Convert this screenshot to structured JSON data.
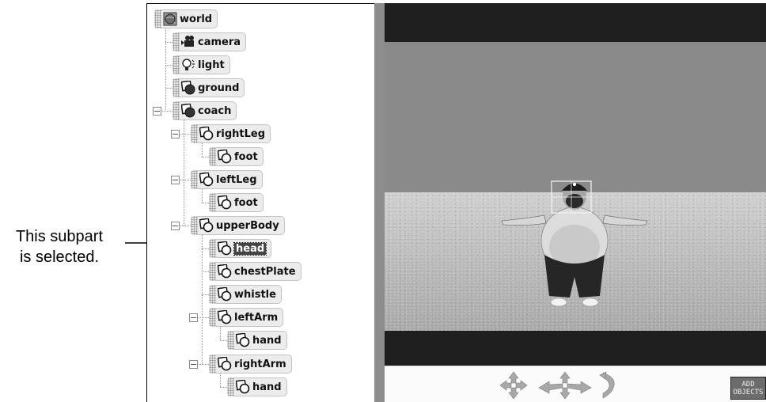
{
  "annotation": {
    "line1": "This subpart",
    "line2": "is selected."
  },
  "tree": {
    "nodes": [
      {
        "label": "world",
        "icon": "world-globe-icon",
        "selected": false
      },
      {
        "label": "camera",
        "icon": "camera-icon",
        "selected": false
      },
      {
        "label": "light",
        "icon": "light-bulb-icon",
        "selected": false
      },
      {
        "label": "ground",
        "icon": "object-icon",
        "selected": false
      },
      {
        "label": "coach",
        "icon": "object-icon",
        "selected": false
      },
      {
        "label": "rightLeg",
        "icon": "object-icon",
        "selected": false
      },
      {
        "label": "foot",
        "icon": "object-icon",
        "selected": false
      },
      {
        "label": "leftLeg",
        "icon": "object-icon",
        "selected": false
      },
      {
        "label": "foot",
        "icon": "object-icon",
        "selected": false
      },
      {
        "label": "upperBody",
        "icon": "object-icon",
        "selected": false
      },
      {
        "label": "head",
        "icon": "object-icon",
        "selected": true
      },
      {
        "label": "chestPlate",
        "icon": "object-icon",
        "selected": false
      },
      {
        "label": "whistle",
        "icon": "object-icon",
        "selected": false
      },
      {
        "label": "leftArm",
        "icon": "object-icon",
        "selected": false
      },
      {
        "label": "hand",
        "icon": "object-icon",
        "selected": false
      },
      {
        "label": "rightArm",
        "icon": "object-icon",
        "selected": false
      },
      {
        "label": "hand",
        "icon": "object-icon",
        "selected": false
      }
    ]
  },
  "view": {
    "controls": [
      "move-arrows-icon",
      "move-horizontal-arrows-icon",
      "turn-icon"
    ],
    "add_objects_line1": "ADD",
    "add_objects_line2": "OBJECTS"
  },
  "colors": {
    "selection": "#444444",
    "sky": "#8a8a8a",
    "letterbox": "#1f1f1f",
    "splitter": "#8d8d8d"
  }
}
